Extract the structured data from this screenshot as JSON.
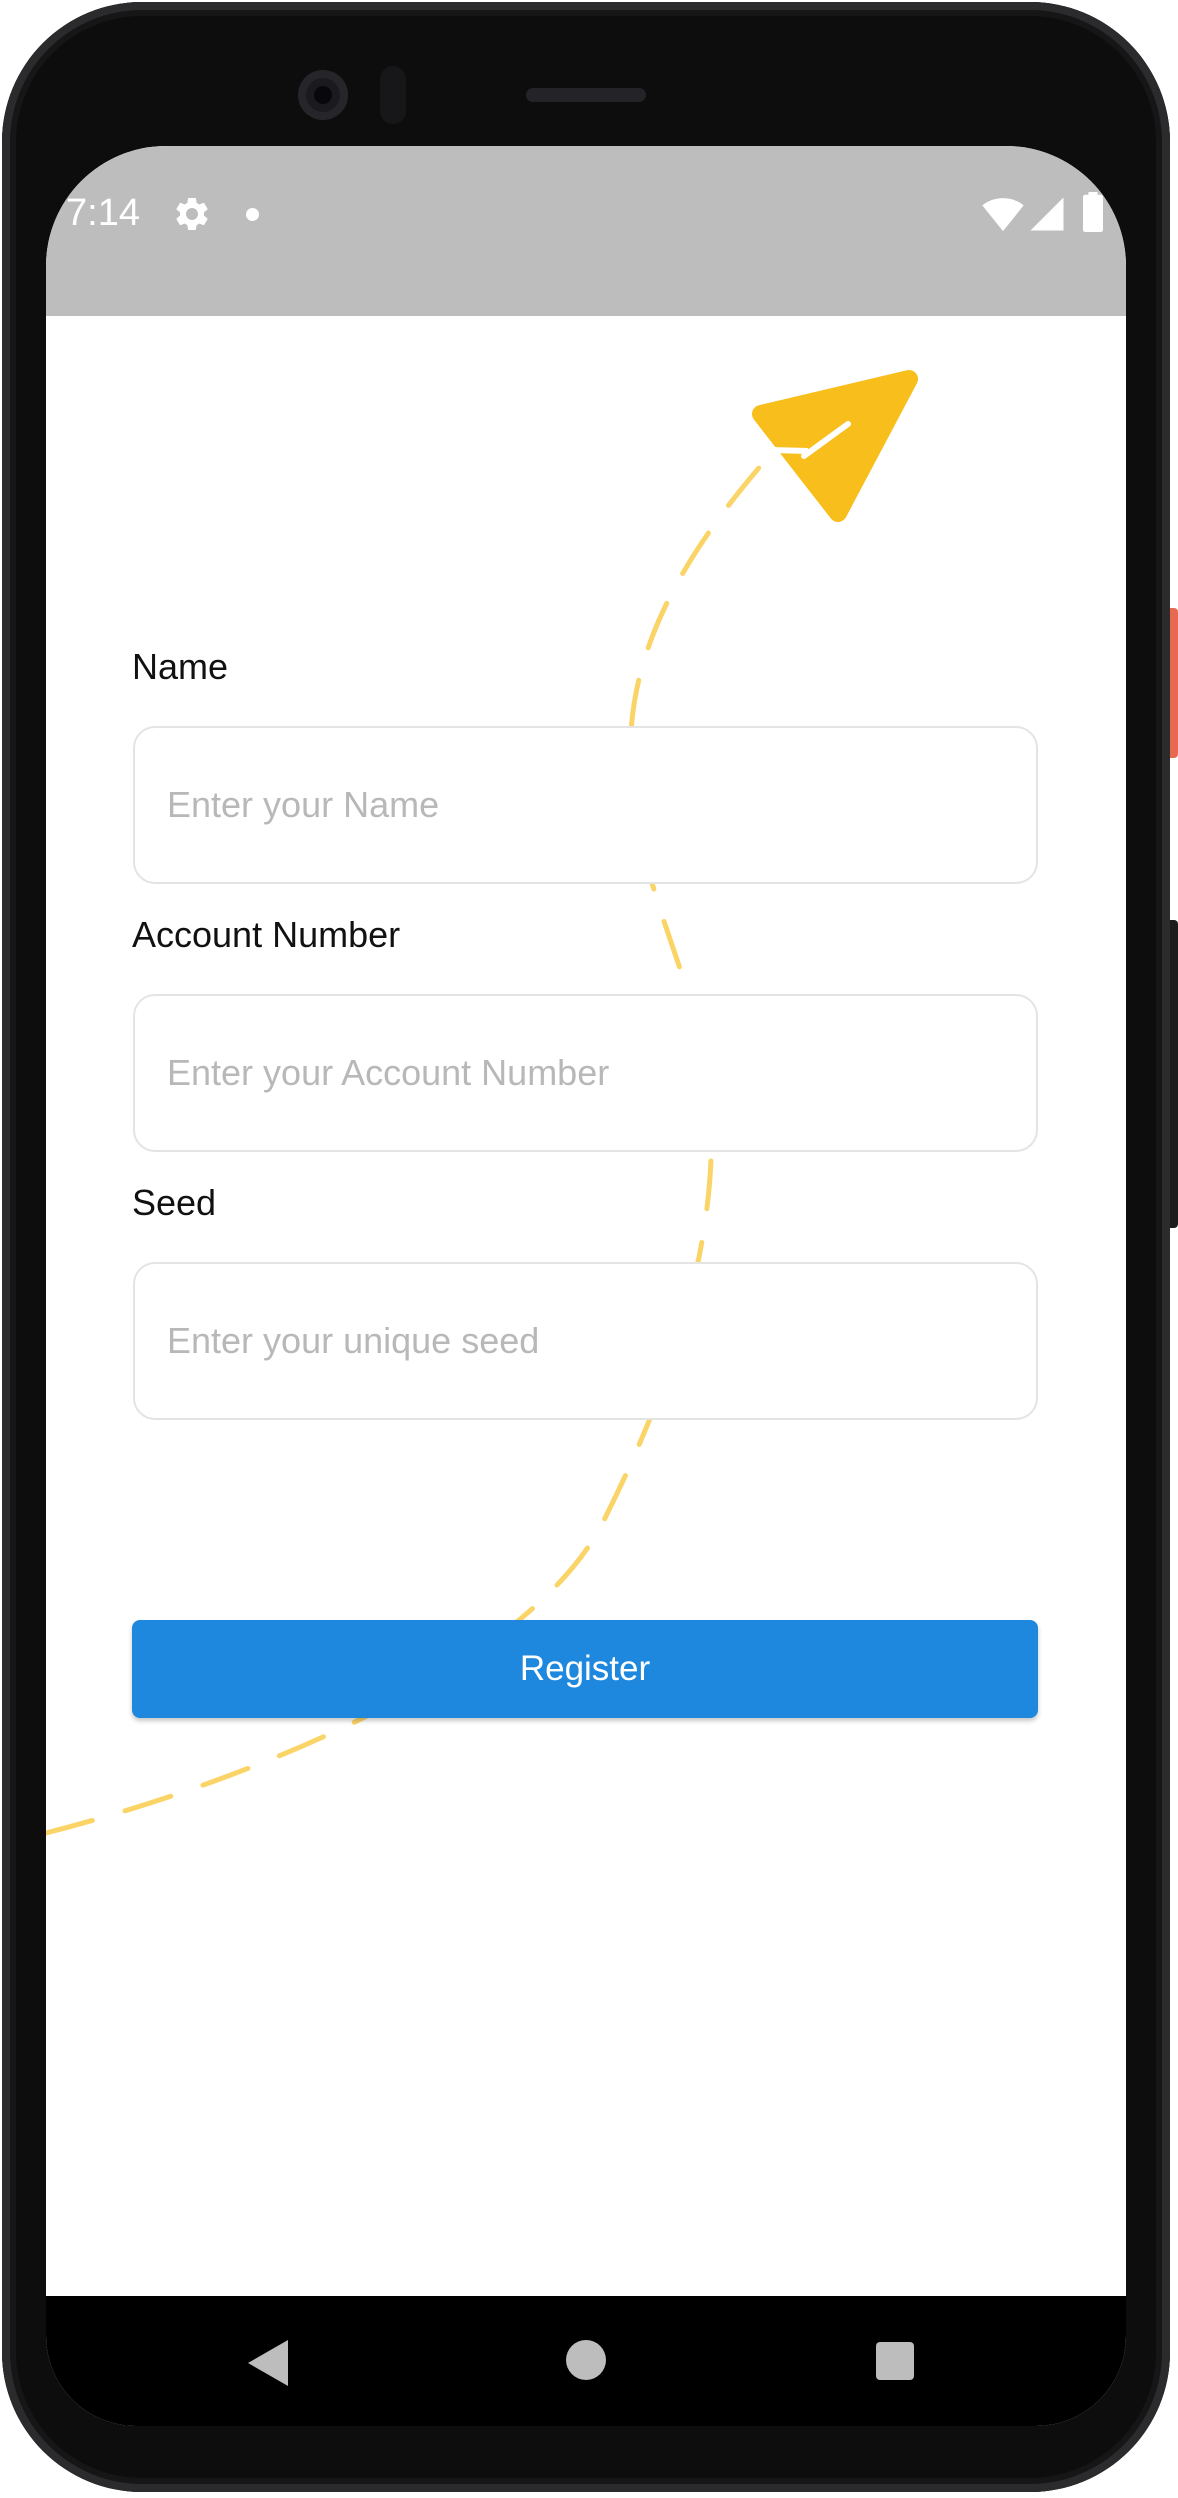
{
  "status_bar": {
    "time": "7:14",
    "icons": [
      "gear-icon",
      "notification-dot-icon",
      "wifi-icon",
      "cell-signal-icon",
      "battery-icon"
    ]
  },
  "form": {
    "name": {
      "label": "Name",
      "placeholder": "Enter your Name",
      "value": ""
    },
    "account_number": {
      "label": "Account Number",
      "placeholder": "Enter your Account Number",
      "value": ""
    },
    "seed": {
      "label": "Seed",
      "placeholder": "Enter your unique seed",
      "value": ""
    }
  },
  "register_button": {
    "label": "Register"
  },
  "decoration": {
    "icon": "paper-plane-icon",
    "color": "#f8be1b"
  },
  "nav_bar": {
    "icons": [
      "back-icon",
      "home-icon",
      "recents-icon"
    ]
  },
  "colors": {
    "accent": "#1e88de",
    "status_bar": "#bdbdbd",
    "plane": "#f8be1b",
    "trail": "#fbd468"
  }
}
